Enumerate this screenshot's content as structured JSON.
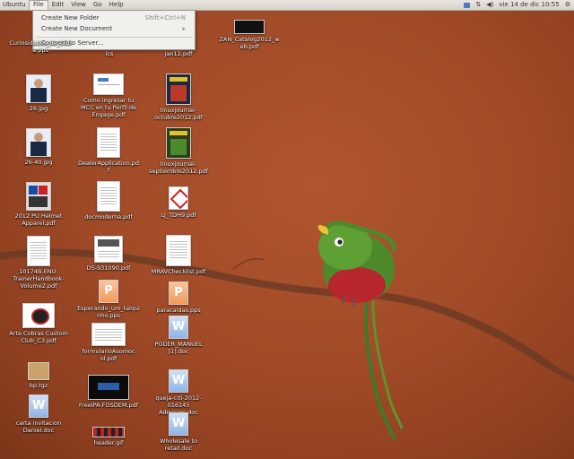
{
  "topbar": {
    "app_name": "Ubuntu",
    "menus": [
      "File",
      "Edit",
      "View",
      "Go",
      "Help"
    ],
    "datetime": "vie 14 de dic  10:55"
  },
  "file_menu": {
    "items": [
      {
        "label": "Create New Folder",
        "shortcut": "Shift+Ctrl+N"
      },
      {
        "label": "Create New Document",
        "shortcut": "▸"
      },
      {
        "label": "Connect to Server...",
        "shortcut": ""
      }
    ]
  },
  "desktop_icons": [
    {
      "label": "Curiosidades_de_Cuba.pps",
      "type": "doc"
    },
    {
      "label": "ics",
      "type": "doc"
    },
    {
      "label": "jan12.pdf",
      "type": "doc"
    },
    {
      "label": "ZAN_Catalog2012_web.pdf",
      "type": "dark"
    },
    {
      "label": "26.jpg",
      "type": "photo"
    },
    {
      "label": "Como ingresar tu MCC en tu Perfil de Engage.pdf",
      "type": "doc"
    },
    {
      "label": "linuxjournal-octubre2012.pdf",
      "type": "magazine"
    },
    {
      "label": "26-40.jpg",
      "type": "photo"
    },
    {
      "label": "DealerApplication.pdf",
      "type": "doc"
    },
    {
      "label": "linuxjournal-septiembre2012.pdf",
      "type": "magazine2"
    },
    {
      "label": "2012 PU Helmet Apparel.pdf",
      "type": "helmet"
    },
    {
      "label": "docmoderna.pdf",
      "type": "doc"
    },
    {
      "label": "LJ_TDH9.pdf",
      "type": "pdf"
    },
    {
      "label": "10174B-ENU-TrainerHandbook-Volume2.pdf",
      "type": "doc"
    },
    {
      "label": "DS-931090.pdf",
      "type": "doc"
    },
    {
      "label": "MRAVChecklist.pdf",
      "type": "doc"
    },
    {
      "label": "Arte Cobras Custom Club_C3.pdf",
      "type": "logo"
    },
    {
      "label": "Esperando_um_talquinho.pps",
      "type": "pps"
    },
    {
      "label": "paracaidas.pps",
      "type": "pps"
    },
    {
      "label": "formularioAsomoc ol.pdf",
      "type": "doc"
    },
    {
      "label": "PODER_MANUEL [1].doc",
      "type": "word"
    },
    {
      "label": "bp.tgz",
      "type": "archive"
    },
    {
      "label": "queja-citi-2012-016145 Admision.doc",
      "type": "word"
    },
    {
      "label": "carta invitacion Daniel.doc",
      "type": "word"
    },
    {
      "label": "FreeIPA-FOSDEM.pdf",
      "type": "dark"
    },
    {
      "label": "header.gif",
      "type": "header"
    },
    {
      "label": "Wholesale to retail.doc",
      "type": "word"
    }
  ]
}
